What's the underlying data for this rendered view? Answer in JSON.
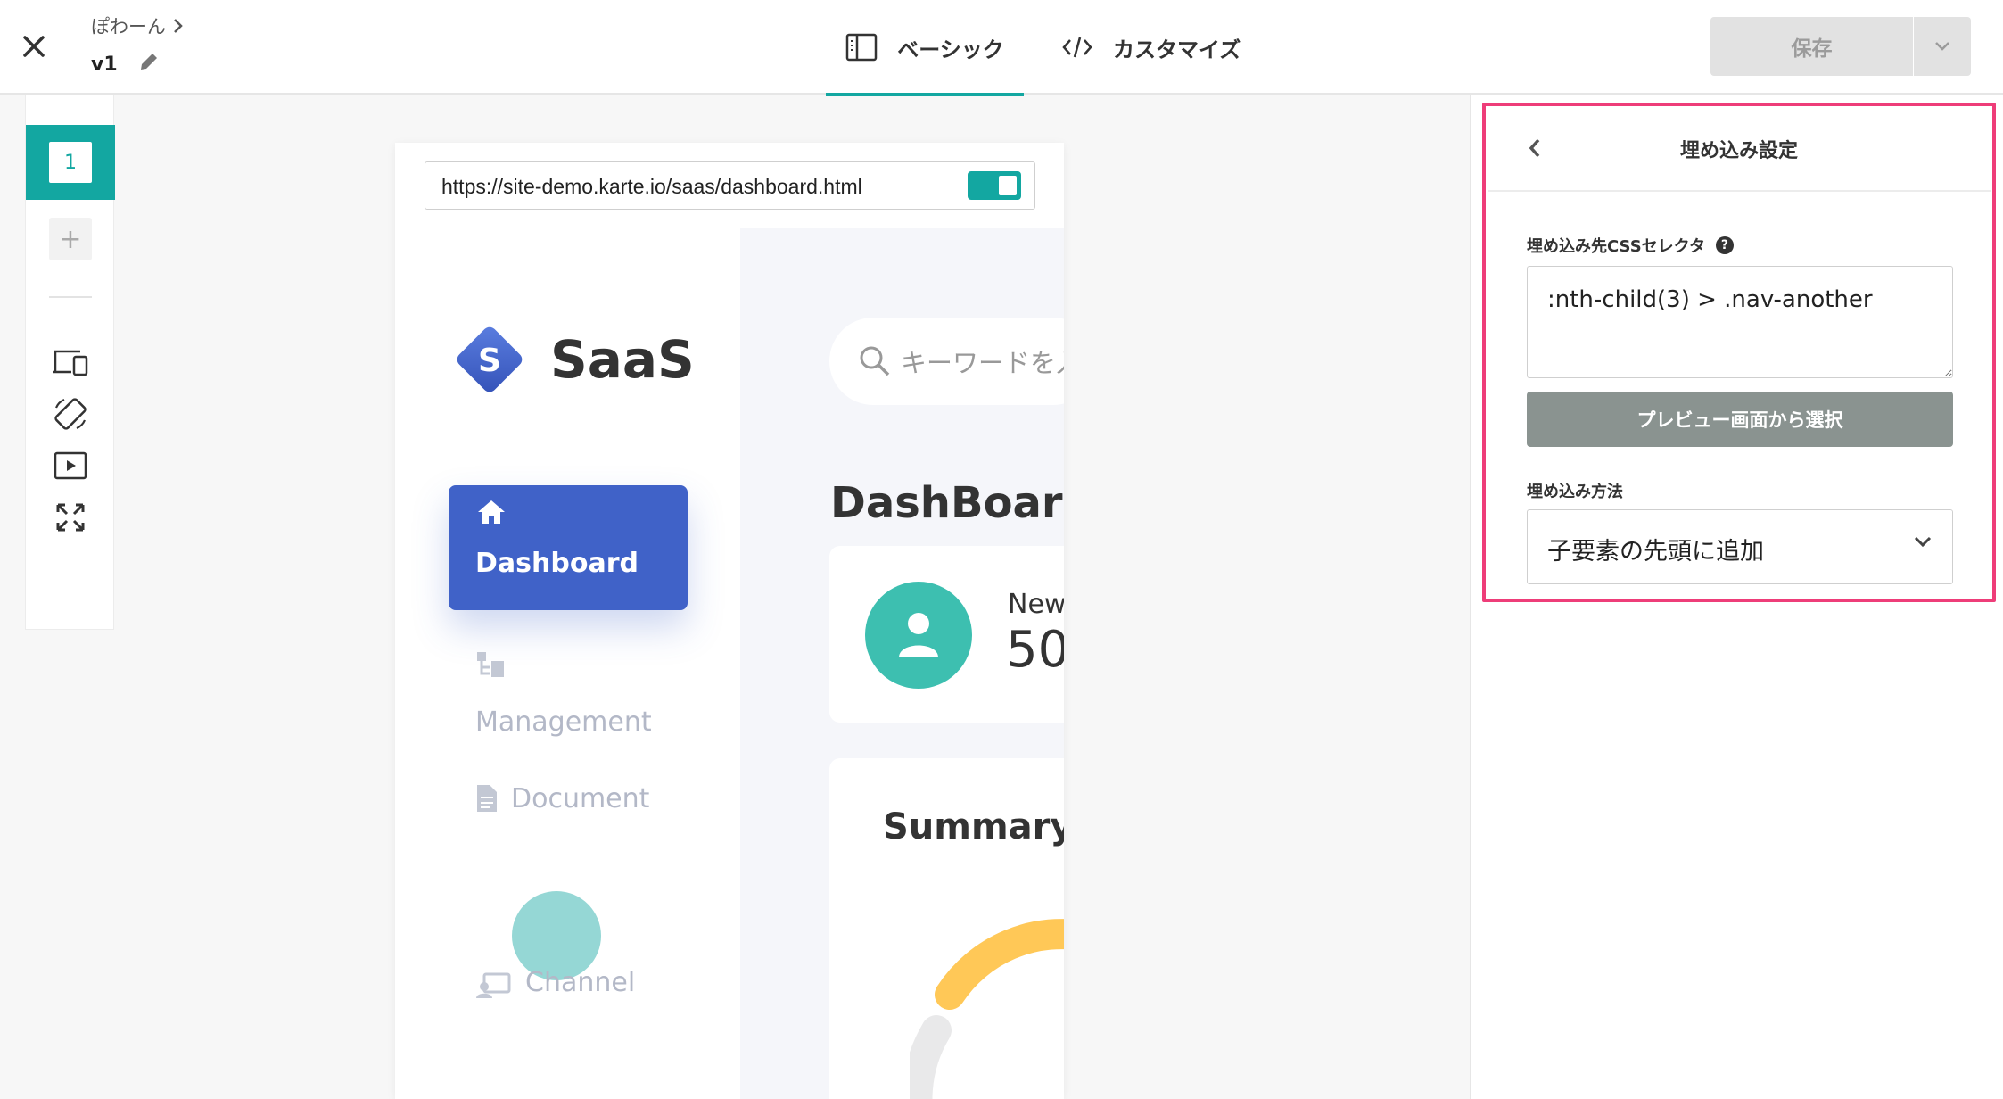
{
  "header": {
    "breadcrumb": "ぽわーん",
    "version": "v1",
    "tabs": [
      {
        "label": "ベーシック",
        "active": true
      },
      {
        "label": "カスタマイズ",
        "active": false
      }
    ],
    "save_label": "保存",
    "accent_color": "#13a7a1"
  },
  "left_toolbar": {
    "active_page": "1",
    "add_label": "+",
    "icons": [
      "devices-icon",
      "rotate-icon",
      "play-icon",
      "fullscreen-icon"
    ]
  },
  "preview": {
    "url": "https://site-demo.karte.io/saas/dashboard.html",
    "toggle_on": true,
    "site": {
      "logo_letter": "S",
      "logo_text": "SaaS",
      "nav": [
        {
          "label": "Dashboard",
          "icon": "home-icon",
          "active": true
        },
        {
          "label": "Management",
          "icon": "management-icon",
          "active": false
        },
        {
          "label": "Document",
          "icon": "document-icon",
          "active": false
        },
        {
          "label": "Channel",
          "icon": "channel-icon",
          "active": false
        }
      ],
      "search_placeholder": "キーワードを入",
      "page_title": "DashBoard",
      "card_label": "New",
      "card_value": "50",
      "summary_title": "Summary",
      "brand_color": "#4062c8"
    }
  },
  "panel": {
    "title": "埋め込み設定",
    "selector_label": "埋め込み先CSSセレクタ",
    "selector_value": ":nth-child(3) > .nav-another",
    "pick_button": "プレビュー画面から選択",
    "method_label": "埋め込み方法",
    "method_value": "子要素の先頭に追加",
    "highlight_color": "#ee3d79"
  }
}
